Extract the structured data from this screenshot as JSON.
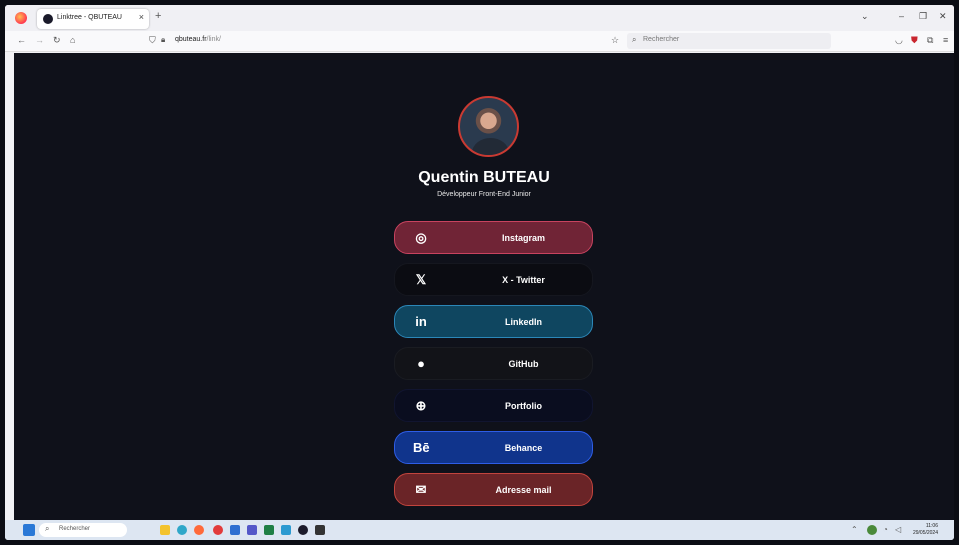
{
  "browser": {
    "tab_title": "Linktree - QBUTEAU",
    "tab_close": "×",
    "new_tab": "+",
    "url_host": "qbuteau.fr",
    "url_path": "/link/",
    "search_placeholder": "Rechercher"
  },
  "profile": {
    "name": "Quentin BUTEAU",
    "subtitle": "Développeur Front-End Junior"
  },
  "links": [
    {
      "label": "Instagram",
      "icon": "instagram-icon",
      "bg": "#702436",
      "border": "#c8435f"
    },
    {
      "label": "X - Twitter",
      "icon": "x-twitter-icon",
      "bg": "#0b0c12",
      "border": "#15171f"
    },
    {
      "label": "LinkedIn",
      "icon": "linkedin-icon",
      "bg": "#0f4660",
      "border": "#2b87b8"
    },
    {
      "label": "GitHub",
      "icon": "github-icon",
      "bg": "#121318",
      "border": "#1a1c22"
    },
    {
      "label": "Portfolio",
      "icon": "globe-icon",
      "bg": "#0a0d1f",
      "border": "#111530"
    },
    {
      "label": "Behance",
      "icon": "behance-icon",
      "bg": "#10348c",
      "border": "#2e5de6"
    },
    {
      "label": "Adresse mail",
      "icon": "mail-icon",
      "bg": "#6a2427",
      "border": "#c2443d"
    }
  ],
  "taskbar": {
    "search_placeholder": "Rechercher",
    "time": "11:06",
    "date": "29/05/2024"
  }
}
